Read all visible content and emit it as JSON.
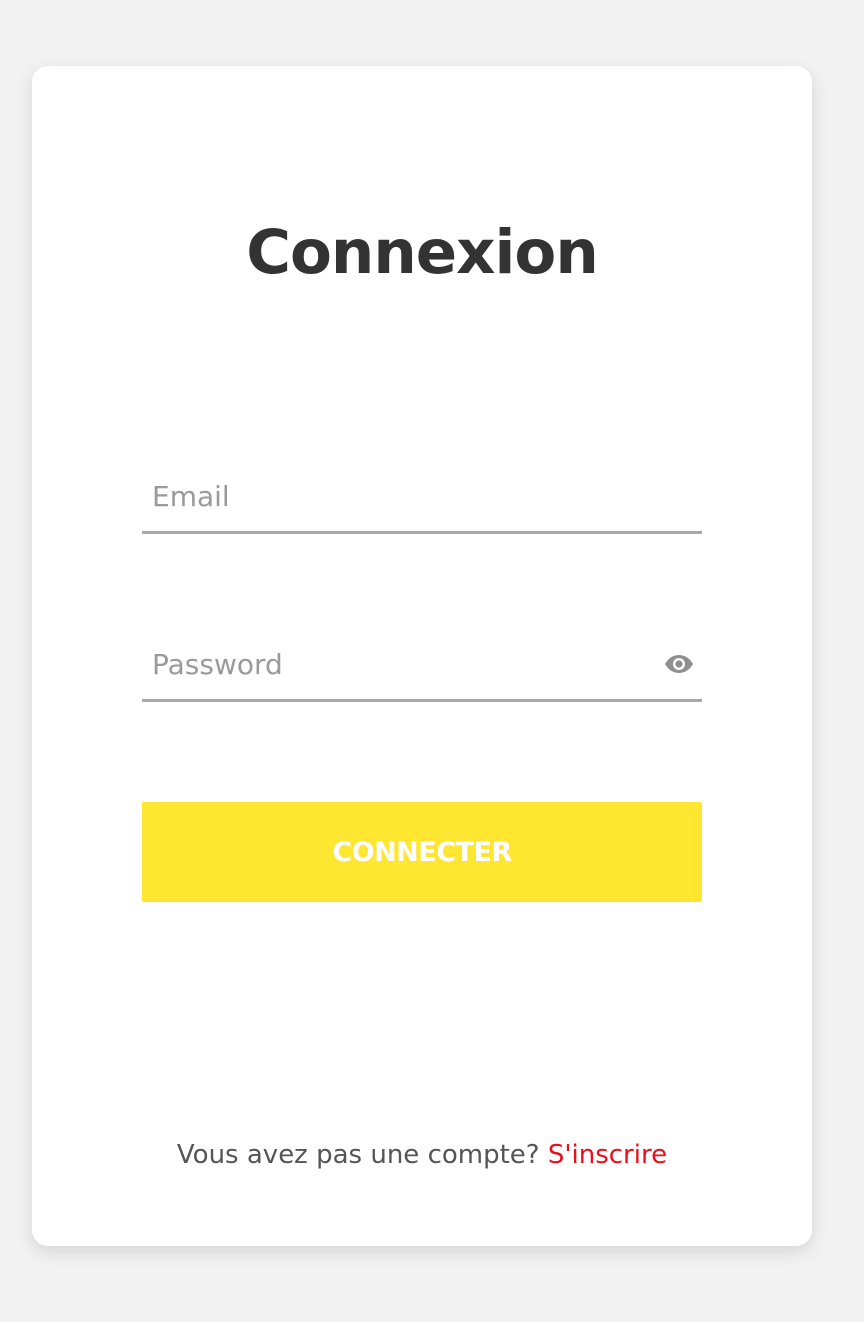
{
  "login": {
    "title": "Connexion",
    "email": {
      "value": "",
      "placeholder": "Email"
    },
    "password": {
      "value": "",
      "placeholder": "Password",
      "toggle_icon": "eye-icon"
    },
    "submit_label": "CONNECTER",
    "footer": {
      "prompt": "Vous avez pas une compte?",
      "link_label": "S'inscrire"
    }
  },
  "colors": {
    "background": "#f2f2f2",
    "card": "#ffffff",
    "title": "#333333",
    "input_underline": "#a9a9a9",
    "placeholder": "#9a9a9a",
    "button": "#fee631",
    "button_text": "#ffffff",
    "link": "#e8101c"
  }
}
